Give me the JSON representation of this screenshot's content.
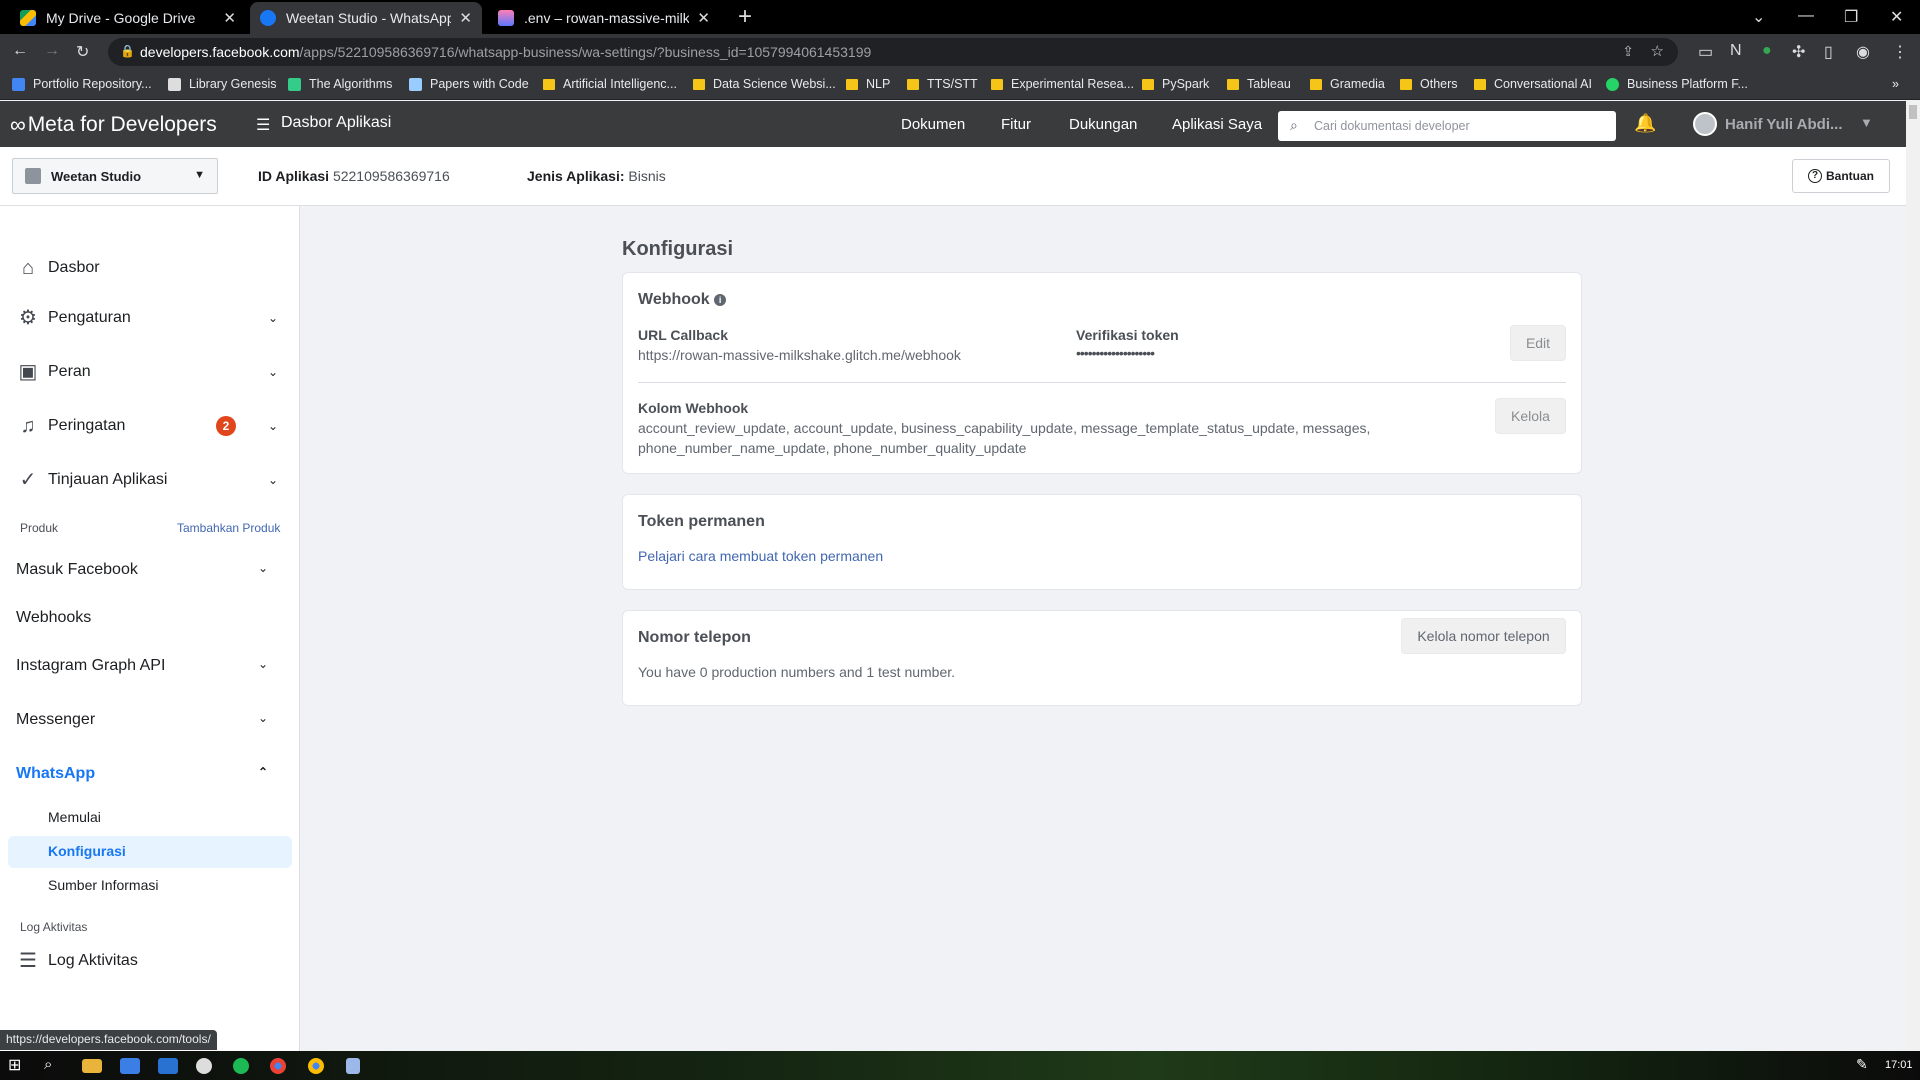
{
  "browser": {
    "tabs": [
      {
        "title": "My Drive - Google Drive",
        "active": false,
        "icon": "google-drive-icon"
      },
      {
        "title": "Weetan Studio - WhatsApp - Fac",
        "active": true,
        "icon": "facebook-icon"
      },
      {
        "title": ".env – rowan-massive-milkshake",
        "active": false,
        "icon": "glitch-icon"
      }
    ],
    "url_host": "developers.facebook.com",
    "url_path": "/apps/522109586369716/whatsapp-business/wa-settings/?business_id=1057994061453199",
    "bookmarks": [
      "Portfolio Repository...",
      "Library Genesis",
      "The Algorithms",
      "Papers with Code",
      "Artificial Intelligenc...",
      "Data Science Websi...",
      "NLP",
      "TTS/STT",
      "Experimental Resea...",
      "PySpark",
      "Tableau",
      "Gramedia",
      "Others",
      "Conversational AI",
      "Business Platform F..."
    ],
    "status_url": "https://developers.facebook.com/tools/"
  },
  "header": {
    "logo": "Meta for Developers",
    "app_dashboard": "Dasbor Aplikasi",
    "nav": [
      "Dokumen",
      "Fitur",
      "Dukungan",
      "Aplikasi Saya"
    ],
    "search_placeholder": "Cari dokumentasi developer",
    "user_name": "Hanif Yuli Abdi..."
  },
  "appbar": {
    "app_name": "Weetan Studio",
    "app_id_label": "ID Aplikasi",
    "app_id": "522109586369716",
    "app_type_label": "Jenis Aplikasi:",
    "app_type": "Bisnis",
    "help": "Bantuan"
  },
  "sidebar": {
    "dashboard": "Dasbor",
    "settings": "Pengaturan",
    "roles": "Peran",
    "alerts": "Peringatan",
    "alerts_count": "2",
    "app_review": "Tinjauan Aplikasi",
    "products_label": "Produk",
    "add_product": "Tambahkan Produk",
    "products": [
      "Masuk Facebook",
      "Webhooks",
      "Instagram Graph API",
      "Messenger",
      "WhatsApp"
    ],
    "whatsapp_sub": [
      "Memulai",
      "Konfigurasi",
      "Sumber Informasi"
    ],
    "activity_label": "Log Aktivitas",
    "activity_log": "Log Aktivitas"
  },
  "content": {
    "title": "Konfigurasi",
    "webhook": {
      "title": "Webhook",
      "callback_label": "URL Callback",
      "callback_url": "https://rowan-massive-milkshake.glitch.me/webhook",
      "token_label": "Verifikasi token",
      "token_value": "••••••••••••••••••••",
      "edit": "Edit",
      "fields_label": "Kolom Webhook",
      "fields_line1": "account_review_update, account_update, business_capability_update, message_template_status_update, messages,",
      "fields_line2": "phone_number_name_update, phone_number_quality_update",
      "manage": "Kelola"
    },
    "token": {
      "title": "Token permanen",
      "link": "Pelajari cara membuat token permanen"
    },
    "phone": {
      "title": "Nomor telepon",
      "button": "Kelola nomor telepon",
      "text": "You have 0 production numbers and 1 test number."
    }
  },
  "taskbar": {
    "time": "17:01"
  }
}
